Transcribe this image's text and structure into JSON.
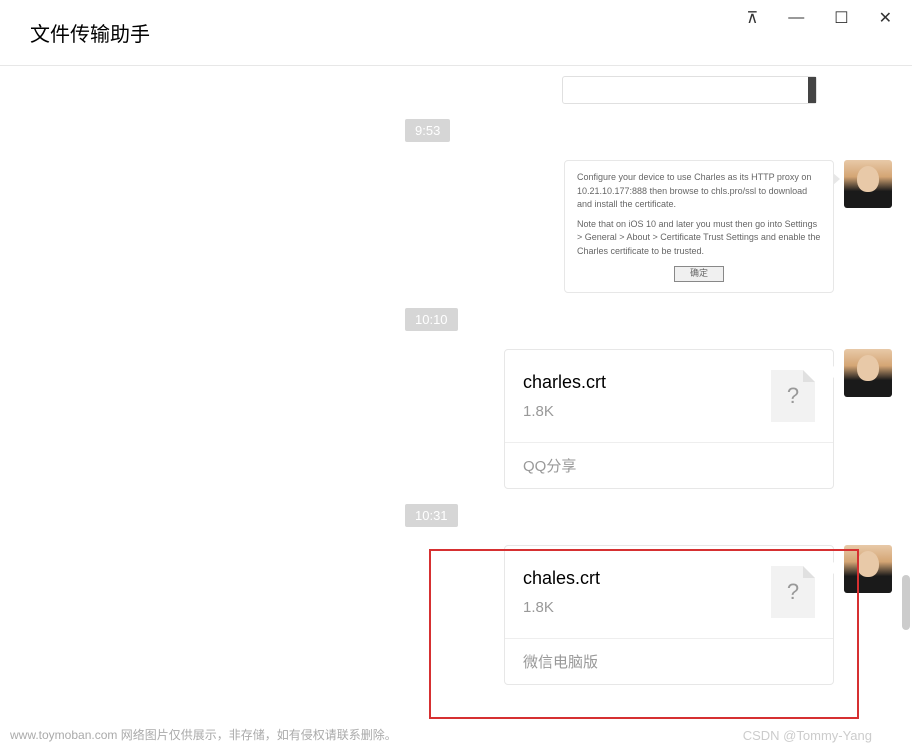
{
  "header": {
    "title": "文件传输助手"
  },
  "window_controls": {
    "pin": "⊼",
    "min": "—",
    "max": "☐",
    "close": "✕"
  },
  "timestamps": {
    "t1": "9:53",
    "t2": "10:10",
    "t3": "10:31"
  },
  "dialog_msg": {
    "line1": "Configure your device to use Charles as its HTTP proxy on 10.21.10.177:888 then browse to chls.pro/ssl to download and install the certificate.",
    "line2": "Note that on iOS 10 and later you must then go into Settings > General > About > Certificate Trust Settings and enable the Charles certificate to be trusted.",
    "button": "确定"
  },
  "file1": {
    "name": "charles.crt",
    "size": "1.8K",
    "source": "QQ分享",
    "icon": "?"
  },
  "file2": {
    "name": "chales.crt",
    "size": "1.8K",
    "source": "微信电脑版",
    "icon": "?"
  },
  "footer": {
    "disclaimer": "www.toymoban.com 网络图片仅供展示，非存储，如有侵权请联系删除。",
    "watermark": "CSDN @Tommy-Yang"
  }
}
